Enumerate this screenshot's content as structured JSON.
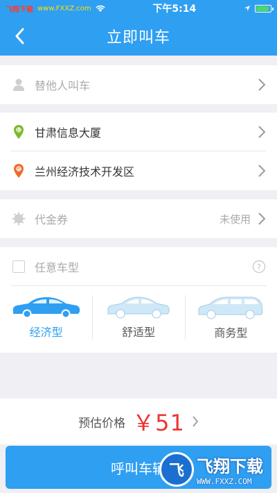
{
  "status_bar": {
    "carrier": "飞翔下载",
    "site": "www.FXXZ.com",
    "time": "下午5:14",
    "battery_level": 0.8
  },
  "nav": {
    "title": "立即叫车",
    "back_icon": "chevron-left-icon"
  },
  "for_others": {
    "label": "替他人叫车",
    "icon": "person-icon"
  },
  "route": {
    "start": {
      "label": "甘肃信息大厦",
      "icon": "start-pin-icon",
      "color": "#7cb82f"
    },
    "end": {
      "label": "兰州经济技术开发区",
      "icon": "end-pin-icon",
      "color": "#f06a2a"
    }
  },
  "coupon": {
    "label": "代金券",
    "status": "未使用",
    "icon": "coupon-icon"
  },
  "car_type": {
    "any_label": "任意车型",
    "help_icon": "question-icon",
    "options": [
      {
        "label": "经济型",
        "selected": true
      },
      {
        "label": "舒适型",
        "selected": false
      },
      {
        "label": "商务型",
        "selected": false
      }
    ]
  },
  "price": {
    "label": "预估价格",
    "value": "￥51"
  },
  "call_button": {
    "label": "呼叫车辆"
  },
  "watermark": {
    "logo": "飞",
    "big": "飞翔下载",
    "small": "WWW.FXXZ.COM"
  },
  "colors": {
    "accent": "#2f9ff2",
    "price": "#ee3333"
  }
}
